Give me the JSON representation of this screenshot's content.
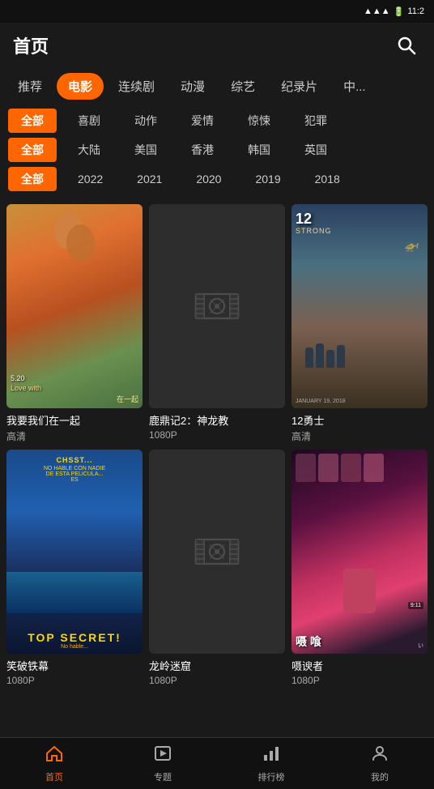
{
  "statusBar": {
    "time": "11:2",
    "batteryIcon": "🔋",
    "wifiIcon": "📶"
  },
  "header": {
    "title": "首页",
    "searchLabel": "搜索"
  },
  "navTabs": [
    {
      "id": "recommend",
      "label": "推荐",
      "active": false
    },
    {
      "id": "movie",
      "label": "电影",
      "active": true
    },
    {
      "id": "series",
      "label": "连续剧",
      "active": false
    },
    {
      "id": "anime",
      "label": "动漫",
      "active": false
    },
    {
      "id": "variety",
      "label": "综艺",
      "active": false
    },
    {
      "id": "documentary",
      "label": "纪录片",
      "active": false
    },
    {
      "id": "other",
      "label": "中...",
      "active": false
    }
  ],
  "genreFilter": {
    "options": [
      {
        "label": "全部",
        "active": true
      },
      {
        "label": "喜剧",
        "active": false
      },
      {
        "label": "动作",
        "active": false
      },
      {
        "label": "爱情",
        "active": false
      },
      {
        "label": "惊悚",
        "active": false
      },
      {
        "label": "犯罪",
        "active": false
      }
    ]
  },
  "regionFilter": {
    "options": [
      {
        "label": "全部",
        "active": true
      },
      {
        "label": "大陆",
        "active": false
      },
      {
        "label": "美国",
        "active": false
      },
      {
        "label": "香港",
        "active": false
      },
      {
        "label": "韩国",
        "active": false
      },
      {
        "label": "英国",
        "active": false
      }
    ]
  },
  "yearFilter": {
    "options": [
      {
        "label": "全部",
        "active": true
      },
      {
        "label": "2022",
        "active": false
      },
      {
        "label": "2021",
        "active": false
      },
      {
        "label": "2020",
        "active": false
      },
      {
        "label": "2019",
        "active": false
      },
      {
        "label": "2018",
        "active": false
      }
    ]
  },
  "movies": [
    {
      "id": 1,
      "title": "我要我们在一起",
      "quality": "高清",
      "hasPoster": true,
      "posterType": "faces"
    },
    {
      "id": 2,
      "title": "鹿鼎记2：神龙教",
      "quality": "1080P",
      "hasPoster": false,
      "posterType": "placeholder"
    },
    {
      "id": 3,
      "title": "12勇士",
      "quality": "高清",
      "hasPoster": true,
      "posterType": "action"
    },
    {
      "id": 4,
      "title": "笑破铁幕",
      "quality": "1080P",
      "hasPoster": true,
      "posterType": "topsecret"
    },
    {
      "id": 5,
      "title": "龙岭迷窟",
      "quality": "1080P",
      "hasPoster": false,
      "posterType": "placeholder"
    },
    {
      "id": 6,
      "title": "嗫谀者",
      "quality": "1080P",
      "hasPoster": true,
      "posterType": "dark"
    }
  ],
  "bottomNav": [
    {
      "id": "home",
      "label": "首页",
      "icon": "home",
      "active": true
    },
    {
      "id": "featured",
      "label": "专题",
      "icon": "play",
      "active": false
    },
    {
      "id": "ranking",
      "label": "排行榜",
      "icon": "chart",
      "active": false
    },
    {
      "id": "profile",
      "label": "我的",
      "icon": "user",
      "active": false
    }
  ],
  "accentColor": "#ff6600"
}
